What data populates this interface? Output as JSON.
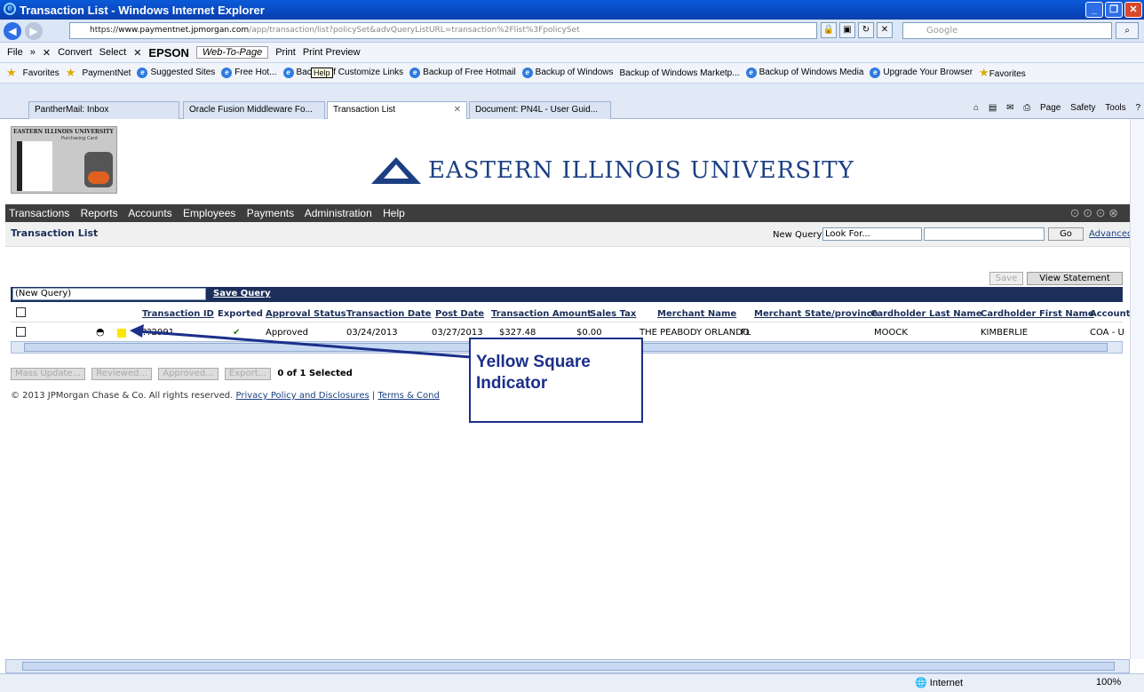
{
  "window": {
    "title": "Transaction List - Windows Internet Explorer"
  },
  "browser": {
    "url_prefix": "https://",
    "url_domain": "www.paymentnet.jpmorgan.com",
    "url_rest": "/app/transaction/list?policySet&advQueryListURL=transaction%2Flist%3FpolicySet",
    "search_placeholder": "Google",
    "menu": {
      "file": "File",
      "convert": "Convert",
      "select": "Select",
      "epson": "EPSON",
      "web_to_page": "Web-To-Page",
      "print": "Print",
      "print_preview": "Print Preview"
    },
    "favorites": [
      "Favorites",
      "PaymentNet",
      "Suggested Sites",
      "Free Hot...",
      "Backup of Customize Links",
      "Backup of Free Hotmail",
      "Backup of Windows",
      "Backup of Windows Marketp...",
      "Backup of Windows Media",
      "Upgrade Your Browser",
      "Favorites"
    ],
    "tooltip": "Help",
    "tabs": [
      "PantherMail: Inbox",
      "Oracle Fusion Middleware Fo...",
      "Transaction List",
      "Document: PN4L - User Guid..."
    ],
    "tab_tools": [
      "Page",
      "Safety",
      "Tools"
    ],
    "status_zone": "Internet",
    "zoom": "100%"
  },
  "logo": {
    "university_small": "EASTERN ILLINOIS UNIVERSITY",
    "card_small": "Purchasing Card",
    "university": "EASTERN ILLINOIS UNIVERSITY"
  },
  "nav": [
    "Transactions",
    "Reports",
    "Accounts",
    "Employees",
    "Payments",
    "Administration",
    "Help"
  ],
  "page": {
    "title": "Transaction List",
    "new_query_label": "New Query",
    "look_for": "Look For...",
    "go": "Go",
    "advanced": "Advanced",
    "save_btn": "Save",
    "view_statement": "View Statement",
    "query_select": "(New Query)",
    "save_query": "Save Query"
  },
  "table": {
    "columns": [
      "Transaction ID",
      "Exported",
      "Approval Status",
      "Transaction Date",
      "Post Date",
      "Transaction Amount",
      "Sales Tax",
      "Merchant Name",
      "Merchant State/province",
      "Cardholder Last Name",
      "Cardholder First Name",
      "Account"
    ],
    "row": {
      "id": "??2991",
      "exported": "✔",
      "status": "Approved",
      "tdate": "03/24/2013",
      "pdate": "03/27/2013",
      "amount": "$327.48",
      "tax": "$0.00",
      "merchant": "THE PEABODY ORLANDO",
      "state": "FL",
      "last": "MOOCK",
      "first": "KIMBERLIE",
      "account": "COA - U"
    }
  },
  "actions": {
    "mass_update": "Mass Update...",
    "reviewed": "Reviewed...",
    "approved": "Approved...",
    "export": "Export...",
    "selected": "0 of 1 Selected"
  },
  "footer": {
    "copyright": "© 2013 JPMorgan Chase & Co. All rights reserved.",
    "privacy": "Privacy Policy and Disclosures",
    "terms": "Terms & Cond"
  },
  "callout": {
    "line1": "Yellow Square",
    "line2": "Indicator"
  },
  "colors": {
    "navy": "#1b2f5a",
    "yellow": "#ffe600",
    "callout": "#1b2f8a"
  }
}
